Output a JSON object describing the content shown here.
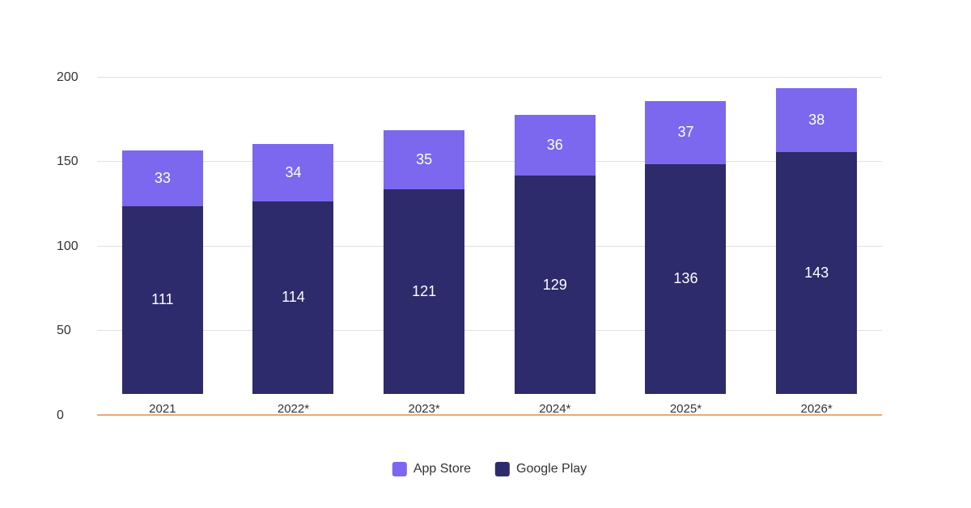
{
  "chart": {
    "y_axis": {
      "labels": [
        "0",
        "50",
        "100",
        "150",
        "200"
      ],
      "max": 220,
      "ticks": [
        0,
        50,
        100,
        150,
        200
      ]
    },
    "bars": [
      {
        "year": "2021",
        "asterisk": false,
        "app_store": 33,
        "google_play": 111,
        "total": 144
      },
      {
        "year": "2022",
        "asterisk": true,
        "app_store": 34,
        "google_play": 114,
        "total": 148
      },
      {
        "year": "2023",
        "asterisk": true,
        "app_store": 35,
        "google_play": 121,
        "total": 156
      },
      {
        "year": "2024",
        "asterisk": true,
        "app_store": 36,
        "google_play": 129,
        "total": 165
      },
      {
        "year": "2025",
        "asterisk": true,
        "app_store": 37,
        "google_play": 136,
        "total": 173
      },
      {
        "year": "2026",
        "asterisk": true,
        "app_store": 38,
        "google_play": 143,
        "total": 181
      }
    ],
    "legend": {
      "app_store_label": "App Store",
      "google_play_label": "Google Play"
    },
    "colors": {
      "app_store": "#7b68ee",
      "google_play": "#2d2b6b",
      "x_axis": "#e8a87c",
      "grid": "#e0e0e0"
    }
  }
}
